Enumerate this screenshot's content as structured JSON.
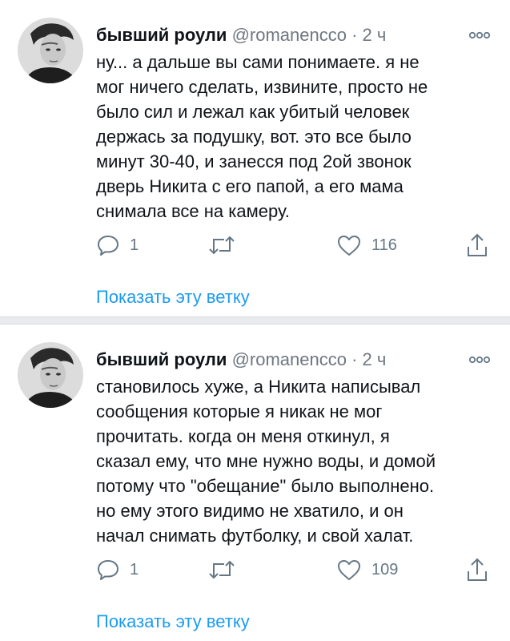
{
  "tweets": [
    {
      "display_name": "бывший роули",
      "handle": "@romanencco",
      "separator": "·",
      "time": "2 ч",
      "text": "ну... а дальше вы сами понимаете. я не\nмог ничего сделать, извините, просто не\nбыло сил и лежал как убитый человек\nдержась за подушку, вот. это все было\nминут 30-40, и занесся под 2ой звонок\nдверь Никита с его папой, а его мама\nснимала все на камеру.",
      "reply_count": "1",
      "like_count": "116",
      "thread_link": "Показать эту ветку"
    },
    {
      "display_name": "бывший роули",
      "handle": "@romanencco",
      "separator": "·",
      "time": "2 ч",
      "text": "становилось хуже, а Никита написывал\nсообщения которые я никак не мог\nпрочитать. когда он меня откинул, я\nсказал ему, что мне нужно воды, и домой\nпотому что \"обещание\" было выполнено.\nно ему этого видимо не хватило, и он\nначал снимать футболку, и свой халат.",
      "reply_count": "1",
      "like_count": "109",
      "thread_link": "Показать эту ветку"
    }
  ],
  "icons": {
    "avatar": "avatar-photo",
    "more": "more-options-icon",
    "reply": "reply-bubble-icon",
    "retweet": "retweet-icon",
    "like": "heart-icon",
    "share": "share-icon"
  },
  "colors": {
    "text": "#0f1419",
    "secondary": "#6e7781",
    "link": "#1d9bf0",
    "separator": "#e8eaed"
  }
}
